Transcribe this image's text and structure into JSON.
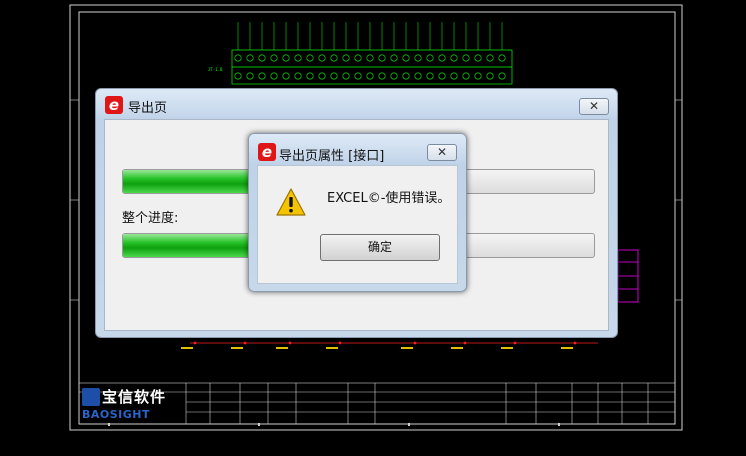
{
  "colors": {
    "accent_green": "#1dbb1d",
    "cad_line": "#d0d0d0",
    "cad_green": "#00ff00",
    "cad_red": "#ff2020",
    "cad_magenta": "#ff00ff",
    "dialog_frame": "#c4d6ea"
  },
  "export_window": {
    "title": "导出页",
    "icon": "e-logo-icon",
    "close_label": "✕",
    "progress_page_fraction": 0.34,
    "overall_label": "整个进度:",
    "progress_overall_fraction": 0.34
  },
  "alert_dialog": {
    "title": "导出页属性 [接口]",
    "icon": "e-logo-icon",
    "close_label": "✕",
    "warning_icon": "warning-icon",
    "message": "EXCEL©-使用错误。",
    "ok_label": "确定"
  },
  "title_block": {
    "logo_cn": "宝信软件",
    "logo_en": "BAOSIGHT"
  }
}
